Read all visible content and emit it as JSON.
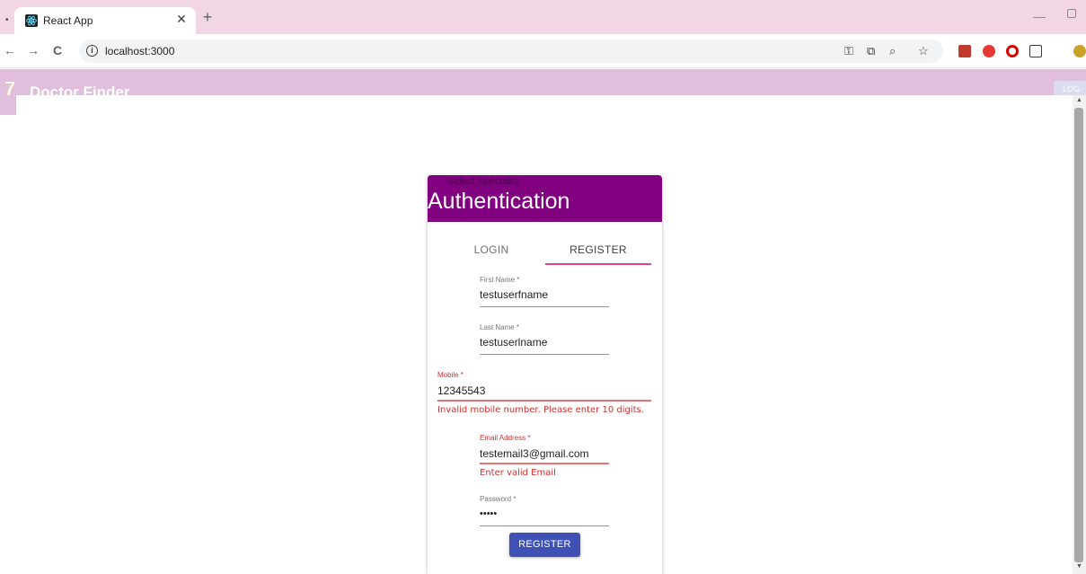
{
  "browser": {
    "tab_title": "React App",
    "tab_close": "✕",
    "new_tab": "+",
    "minimize": "—",
    "back": "←",
    "forward": "→",
    "reload": "C",
    "url": "localhost:3000",
    "icons": [
      "password-key-icon",
      "cast-icon",
      "zoom-icon",
      "bookmark-star-icon"
    ],
    "extensions": [
      "red-extension-icon",
      "adblock-extension-icon",
      "opera-extension-icon",
      "puzzle-extensions-icon",
      "profile-avatar-icon"
    ]
  },
  "app": {
    "title": "Doctor Finder",
    "logo_glyph": "7",
    "header_button": "LOG",
    "primary_color": "#800080"
  },
  "modal": {
    "behind_text": "Select Speciality",
    "title": "Authentication",
    "tabs": {
      "login": "LOGIN",
      "register": "REGISTER"
    },
    "fields": {
      "first_name": {
        "label": "First Name *",
        "value": "testuserfname"
      },
      "last_name": {
        "label": "Last Name *",
        "value": "testuserlname"
      },
      "mobile": {
        "label": "Mobile *",
        "value": "12345543",
        "error": "Invalid mobile number. Please enter 10 digits."
      },
      "email": {
        "label": "Email Address *",
        "value": "testemail3@gmail.com",
        "error": "Enter valid Email"
      },
      "password": {
        "label": "Password *",
        "value": "•••••"
      }
    },
    "submit": "REGISTER",
    "error_color": "#d32f2f",
    "button_color": "#3f51b5"
  }
}
